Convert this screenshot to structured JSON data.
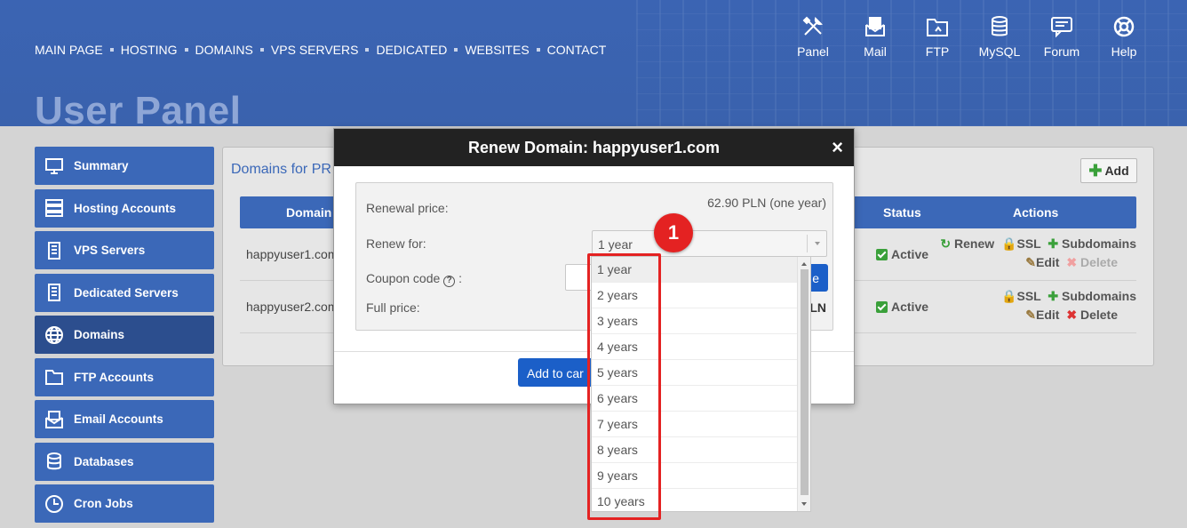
{
  "nav": {
    "items": [
      "MAIN PAGE",
      "HOSTING",
      "DOMAINS",
      "VPS SERVERS",
      "DEDICATED",
      "WEBSITES",
      "CONTACT"
    ]
  },
  "icon_menu": [
    {
      "label": "Panel",
      "icon": "tools-icon"
    },
    {
      "label": "Mail",
      "icon": "mail-icon"
    },
    {
      "label": "FTP",
      "icon": "ftp-icon"
    },
    {
      "label": "MySQL",
      "icon": "database-icon"
    },
    {
      "label": "Forum",
      "icon": "forum-icon"
    },
    {
      "label": "Help",
      "icon": "lifebuoy-icon"
    }
  ],
  "page_title": "User Panel",
  "sidebar": {
    "items": [
      {
        "label": "Summary",
        "icon": "monitor-icon"
      },
      {
        "label": "Hosting Accounts",
        "icon": "server-icon"
      },
      {
        "label": "VPS Servers",
        "icon": "vps-icon"
      },
      {
        "label": "Dedicated Servers",
        "icon": "dedicated-icon"
      },
      {
        "label": "Domains",
        "icon": "globe-icon",
        "active": true
      },
      {
        "label": "FTP Accounts",
        "icon": "folder-icon"
      },
      {
        "label": "Email Accounts",
        "icon": "email-icon"
      },
      {
        "label": "Databases",
        "icon": "database-icon"
      },
      {
        "label": "Cron Jobs",
        "icon": "clock-icon"
      }
    ]
  },
  "panel": {
    "title": "Domains for PR",
    "add_label": "Add",
    "columns": {
      "domain": "Domain",
      "status": "Status",
      "actions": "Actions"
    },
    "rows": [
      {
        "domain": "happyuser1.com",
        "status": "Active",
        "renew": "Renew",
        "ssl": "SSL",
        "subdomains": "Subdomains",
        "edit": "Edit",
        "delete": "Delete"
      },
      {
        "domain": "happyuser2.com",
        "status": "Active",
        "ssl": "SSL",
        "subdomains": "Subdomains",
        "edit": "Edit",
        "delete": "Delete"
      }
    ]
  },
  "modal": {
    "title": "Renew Domain: happyuser1.com",
    "close_label": "×",
    "renewal_price_label": "Renewal price:",
    "renewal_price_value": "62.90 PLN (one year)",
    "renew_for_label": "Renew for:",
    "renew_for_value": "1 year",
    "coupon_label": "Coupon code",
    "coupon_colon": ":",
    "apply_label": "e",
    "full_price_label": "Full price:",
    "full_price_value": "LN",
    "add_to_cart_label": "Add to car"
  },
  "dropdown": {
    "options": [
      "1 year",
      "2 years",
      "3 years",
      "4 years",
      "5 years",
      "6 years",
      "7 years",
      "8 years",
      "9 years",
      "10 years"
    ],
    "selected_index": 0
  },
  "annotation": {
    "marker": "1",
    "color": "#e42222"
  },
  "colors": {
    "header": "#3a63b0",
    "sidebar": "#3b68b8",
    "accent": "#1b5fc8",
    "active": "#3aa03a"
  }
}
